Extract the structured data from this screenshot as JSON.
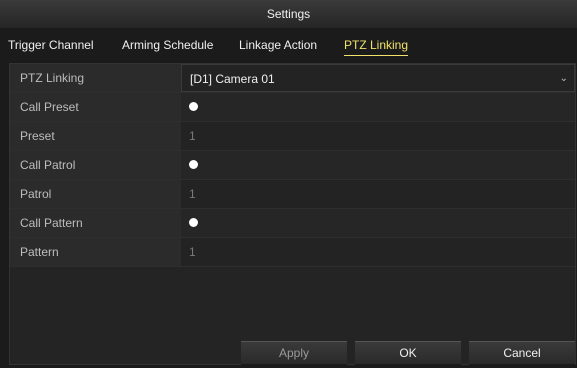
{
  "window": {
    "title": "Settings"
  },
  "tabs": [
    {
      "label": "Trigger Channel",
      "active": false
    },
    {
      "label": "Arming Schedule",
      "active": false
    },
    {
      "label": "Linkage Action",
      "active": false
    },
    {
      "label": "PTZ Linking",
      "active": true
    }
  ],
  "form": {
    "ptz_linking": {
      "label": "PTZ Linking",
      "value": "[D1] Camera 01",
      "icon": "chevron-down-icon"
    },
    "call_preset": {
      "label": "Call Preset",
      "checked": true
    },
    "preset": {
      "label": "Preset",
      "value": "1"
    },
    "call_patrol": {
      "label": "Call Patrol",
      "checked": true
    },
    "patrol": {
      "label": "Patrol",
      "value": "1"
    },
    "call_pattern": {
      "label": "Call Pattern",
      "checked": true
    },
    "pattern": {
      "label": "Pattern",
      "value": "1"
    }
  },
  "buttons": {
    "apply": "Apply",
    "ok": "OK",
    "cancel": "Cancel"
  },
  "colors": {
    "active_tab": "#f2e26a",
    "background": "#1b1b1b"
  }
}
